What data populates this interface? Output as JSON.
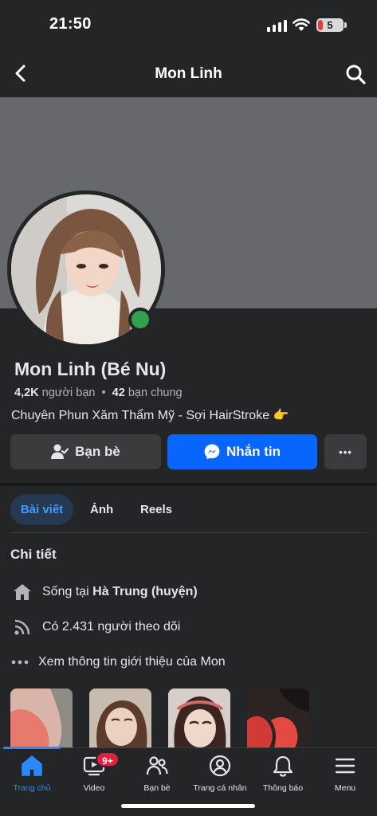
{
  "status_bar": {
    "time": "21:50",
    "battery": "5"
  },
  "nav": {
    "title": "Mon Linh",
    "back_icon": "chevron-left-icon",
    "search_icon": "search-icon"
  },
  "profile": {
    "name": "Mon Linh (Bé Nu)",
    "friends_count": "4,2K",
    "friends_label": "người bạn",
    "separator": "•",
    "mutual_count": "42",
    "mutual_label": "bạn chung",
    "bio": "Chuyên Phun Xăm Thẩm Mỹ - Sợi HairStroke 👉",
    "online": true
  },
  "actions": {
    "friend_label": "Bạn bè",
    "message_label": "Nhắn tin",
    "more_label": "•••"
  },
  "tabs": [
    {
      "label": "Bài viết",
      "active": true
    },
    {
      "label": "Ảnh",
      "active": false
    },
    {
      "label": "Reels",
      "active": false
    }
  ],
  "details": {
    "title": "Chi tiết",
    "lives_prefix": "Sống tại ",
    "lives_place": "Hà Trung (huyện)",
    "followers": "Có 2.431 người theo dõi",
    "see_about": "Xem thông tin giới thiệu của Mon"
  },
  "bottom_nav": [
    {
      "label": "Trang chủ",
      "icon": "home-icon",
      "active": true
    },
    {
      "label": "Video",
      "icon": "video-icon",
      "badge": "9+"
    },
    {
      "label": "Bạn bè",
      "icon": "friends-icon"
    },
    {
      "label": "Trang cá nhân",
      "icon": "profile-icon"
    },
    {
      "label": "Thông báo",
      "icon": "bell-icon"
    },
    {
      "label": "Menu",
      "icon": "menu-icon"
    }
  ],
  "colors": {
    "accent": "#0866ff",
    "online": "#31a24c",
    "badge": "#e41e3f",
    "active_tab": "#4599ff"
  }
}
